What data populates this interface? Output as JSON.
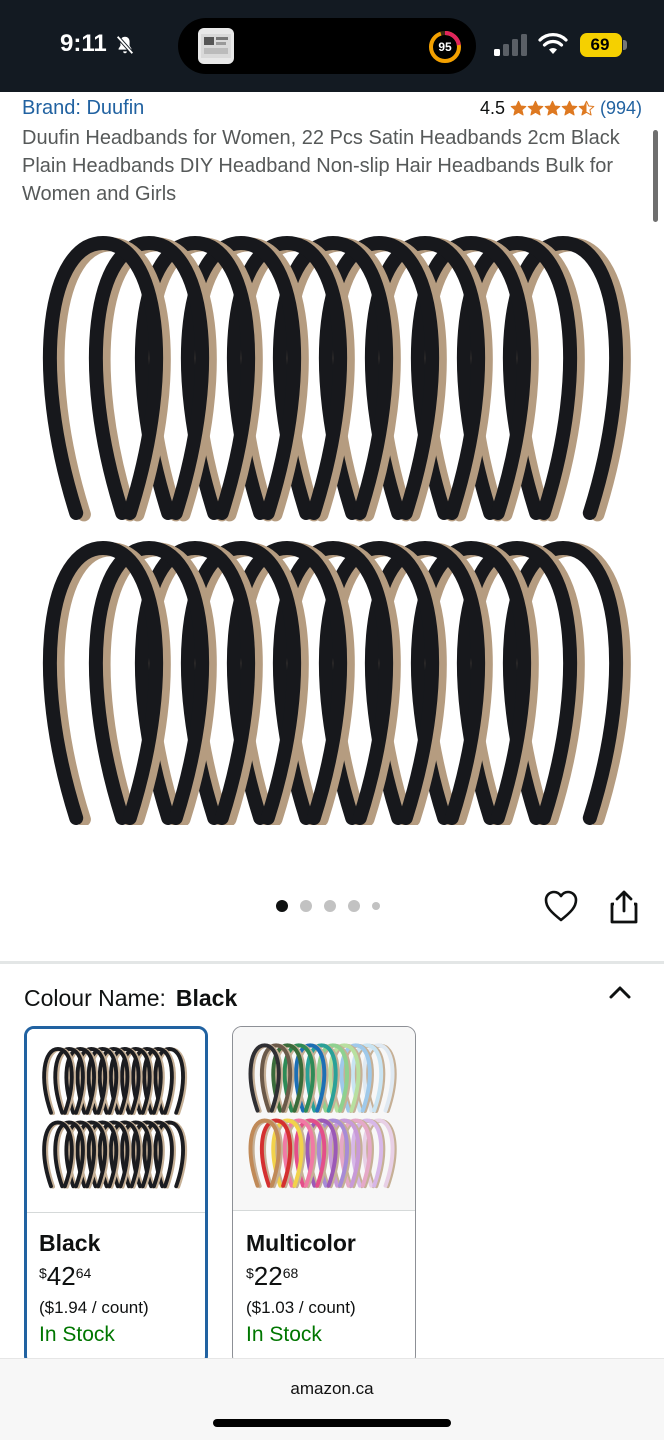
{
  "status_bar": {
    "time": "9:11",
    "notification_badge": "95",
    "battery": "69",
    "icons": [
      "bell-slash-icon",
      "cellular-signal-icon",
      "wifi-icon",
      "battery-icon"
    ]
  },
  "product": {
    "brand": "Brand: Duufin",
    "rating": "4.5",
    "rating_stars": 4.5,
    "review_count": "(994)",
    "title": "Duufin Headbands for Women, 22 Pcs Satin Headbands 2cm Black Plain Headbands DIY Headband Non-slip Hair Headbands Bulk for Women and Girls"
  },
  "gallery": {
    "image_count": 5,
    "active_index": 0,
    "icons": [
      "heart-icon",
      "share-icon"
    ]
  },
  "variation": {
    "label": "Colour Name:",
    "selected": "Black",
    "collapse_icon": "chevron-up-icon",
    "options": [
      {
        "name": "Black",
        "currency": "$",
        "whole": "42",
        "fraction": "64",
        "unit_price": "($1.94 / count)",
        "availability": "In Stock"
      },
      {
        "name": "Multicolor",
        "currency": "$",
        "whole": "22",
        "fraction": "68",
        "unit_price": "($1.03 / count)",
        "availability": "In Stock"
      }
    ]
  },
  "browser": {
    "domain": "amazon.ca"
  },
  "colors": {
    "link": "#2162a1",
    "star": "#de7921",
    "in_stock": "#007600",
    "status_bar_bg": "#131a22"
  }
}
